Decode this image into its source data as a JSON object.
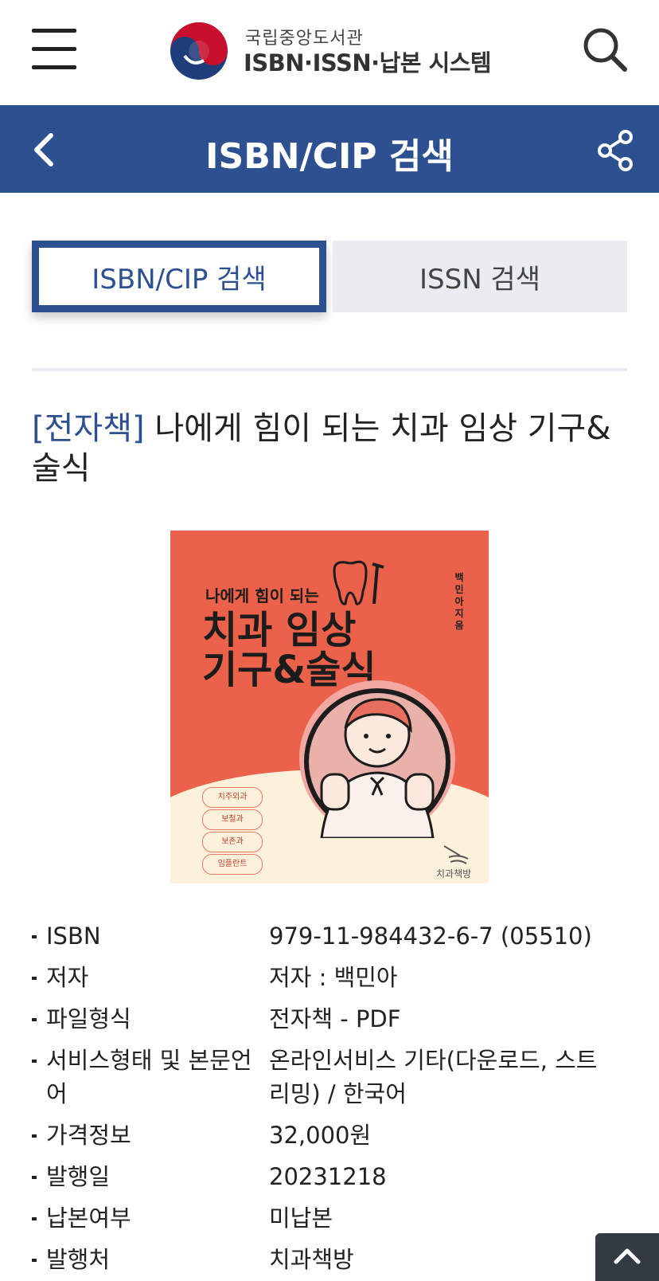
{
  "header": {
    "logo_small": "국립중앙도서관",
    "logo_big": "ISBN·ISSN·납본 시스템",
    "menu_icon": "hamburger-menu-icon",
    "search_icon": "search-icon"
  },
  "titlebar": {
    "title": "ISBN/CIP 검색",
    "back_icon": "chevron-left-icon",
    "share_icon": "share-icon",
    "color": "#2d5190"
  },
  "tabs": [
    {
      "label": "ISBN/CIP 검색",
      "active": true
    },
    {
      "label": "ISSN 검색",
      "active": false
    }
  ],
  "book": {
    "tag": "[전자책]",
    "title": "나에게 힘이 되는 치과 임상 기구&술식"
  },
  "cover": {
    "subtitle": "나에게 힘이 되는",
    "title_line1": "치과 임상",
    "title_line2": "기구&술식",
    "author": "백민아 지음",
    "pills": [
      "치주외과",
      "보철과",
      "보존과",
      "임플란트"
    ],
    "publisher": "치과책방",
    "bg_color": "#eb6149"
  },
  "info": [
    {
      "label": "ISBN",
      "value": "979-11-984432-6-7 (05510)"
    },
    {
      "label": "저자",
      "value": "저자 : 백민아"
    },
    {
      "label": "파일형식",
      "value": "전자책 - PDF"
    },
    {
      "label": "서비스형태 및 본문언어",
      "value": "온라인서비스 기타(다운로드, 스트리밍) / 한국어"
    },
    {
      "label": "가격정보",
      "value": "32,000원"
    },
    {
      "label": "발행일",
      "value": "20231218"
    },
    {
      "label": "납본여부",
      "value": "미납본"
    },
    {
      "label": "발행처",
      "value": "치과책방"
    }
  ],
  "scroll_top_icon": "chevron-up-icon"
}
